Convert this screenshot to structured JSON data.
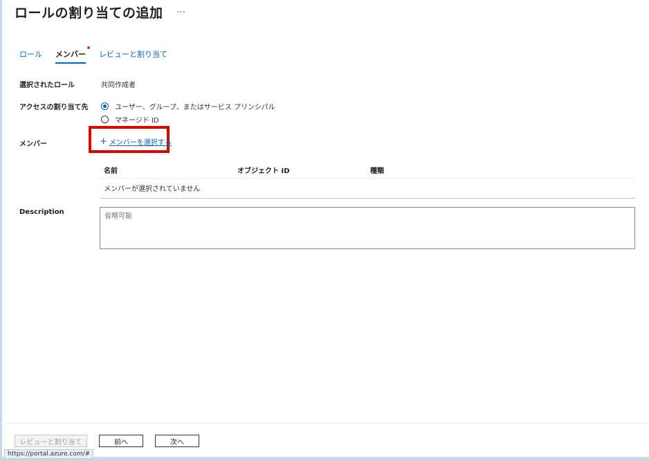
{
  "header": {
    "title": "ロールの割り当ての追加",
    "more_label": "···"
  },
  "tabs": [
    {
      "label": "ロール",
      "active": false
    },
    {
      "label": "メンバー",
      "active": true,
      "required_dot": true
    },
    {
      "label": "レビューと割り当て",
      "active": false
    }
  ],
  "form": {
    "selected_role_label": "選択されたロール",
    "selected_role_value": "共同作成者",
    "assign_access_label": "アクセスの割り当て先",
    "assign_options": [
      {
        "label": "ユーザー、グループ、またはサービス プリンシパル",
        "checked": true
      },
      {
        "label": "マネージド ID",
        "checked": false
      }
    ],
    "members_label": "メンバー",
    "select_members_link": "メンバーを選択する",
    "table": {
      "columns": [
        "名前",
        "オブジェクト ID",
        "種類"
      ],
      "empty_message": "メンバーが選択されていません"
    },
    "description_label": "Description",
    "description_placeholder": "省略可能"
  },
  "footer": {
    "review_button": "レビューと割り当て",
    "prev_button": "前へ",
    "next_button": "次へ"
  },
  "status_url": "https://portal.azure.com/#",
  "colors": {
    "link": "#0067b8",
    "highlight": "#e00000",
    "required_dot": "#d13438"
  }
}
